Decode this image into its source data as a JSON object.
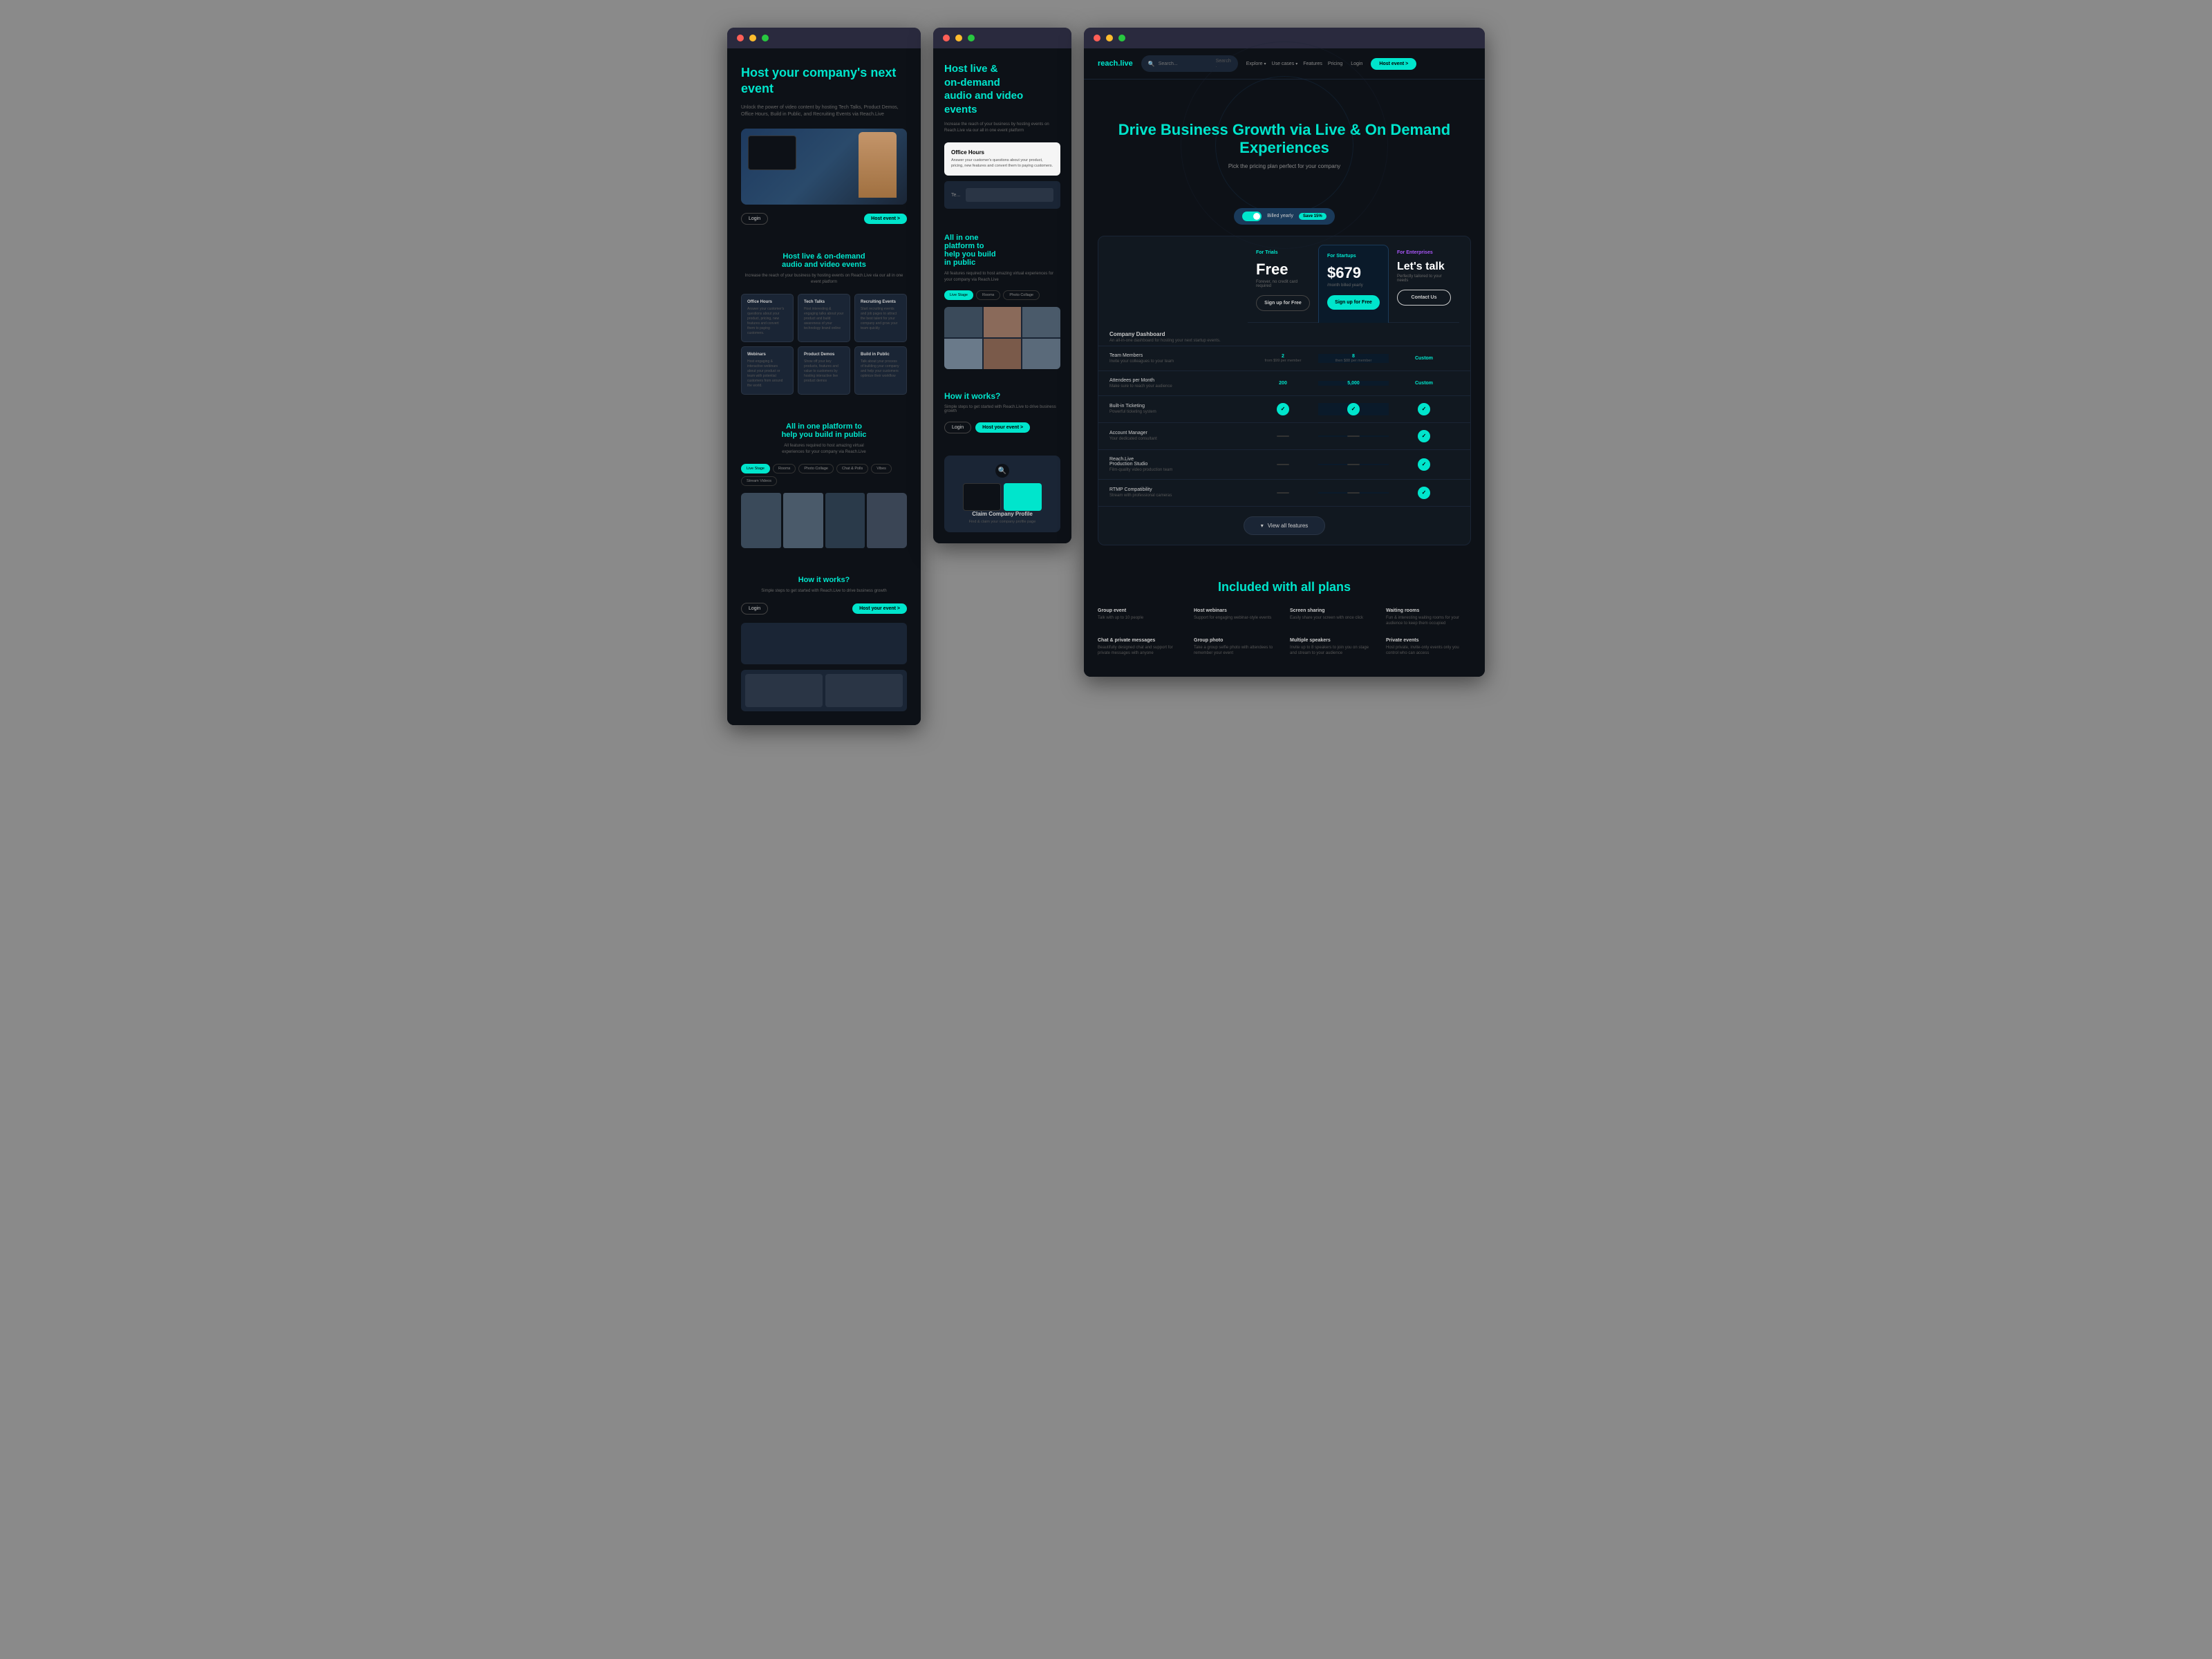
{
  "col1": {
    "hero": {
      "title": "Host your\ncompany's\nnext event",
      "subtitle": "Unlock the power of video content by hosting Tech Talks, Product Demos, Office Hours, Build in Public, and Recruiting Events via Reach.Live",
      "login_btn": "Login",
      "host_btn": "Host event >"
    },
    "section2": {
      "title": "Host live & on-demand\naudio and video events",
      "desc": "Increase the reach of your business by hosting events on\nReach.Live via our all in one event platform",
      "cards": [
        {
          "title": "Office Hours",
          "text": "Answer your customer's questions about your product, pricing, new features and convert them to paying customers."
        },
        {
          "title": "Tech Talks",
          "text": "Host interesting & engaging talks about your product and build awareness of your technology brand online"
        },
        {
          "title": "Recruiting Events",
          "text": "Start recruiting events and job pages to attract the best talent for your company and grow your team quickly"
        },
        {
          "title": "Webinars",
          "text": "Host engaging & interactive webinars about your product or team with potential customers from around the world."
        },
        {
          "title": "Product Demos",
          "text": "Show off your key products, features and value to customers by hosting interactive live product demos"
        },
        {
          "title": "Build in Public",
          "text": "Talk about your process of building your company and help your customers optimize their workflow"
        }
      ]
    },
    "section3": {
      "title": "All in one platform to\nhelp you build in public",
      "desc": "All features required to host amazing virtual\nexperiences for your company via Reach.Live",
      "tabs": [
        "Live Stage",
        "Rooms",
        "Photo Collage",
        "Chat & Polls",
        "Vibes",
        "Stream Videos"
      ]
    },
    "section4": {
      "title": "How it works?",
      "subtitle": "Simple steps to get started with\nReach.Live to drive business growth",
      "login_btn": "Login",
      "host_btn": "Host your event >"
    }
  },
  "col2": {
    "hero": {
      "title": "Host live &\non-demand\naudio and video\nevents",
      "desc": "Increase the reach of your business by hosting events on Reach.Live via our all in one event platform",
      "office_card_title": "Office Hours",
      "office_card_desc": "Answer your customer's questions about your product, pricing, new features and convert them to paying customers."
    },
    "section2": {
      "title": "All in one\nplatform to\nhelp you build\nin public",
      "desc": "All features required to host amazing virtual experiences for your company via Reach.Live",
      "tabs": [
        "Live Stage",
        "Rooms",
        "Photo Collage"
      ]
    },
    "section3": {
      "title": "How it works?",
      "desc": "Simple steps to get started with Reach.Live to drive business growth",
      "login_btn": "Login",
      "host_btn": "Host your event >"
    },
    "claim": {
      "title": "Claim Company Profile",
      "desc": "Find & claim your company profile page"
    }
  },
  "col3": {
    "navbar": {
      "logo": "reach.live",
      "search_placeholder": "Search...",
      "nav_items": [
        "Explore",
        "Use cases",
        "Features",
        "Pricing"
      ],
      "login_btn": "Login",
      "host_btn": "Host event >"
    },
    "pricing_hero": {
      "title": "Drive Business Growth via Live\n& On Demand Experiences",
      "subtitle": "Pick the pricing plan perfect for your company"
    },
    "billing_toggle": {
      "label": "Billed yearly",
      "save": "Save 15%"
    },
    "plans": [
      {
        "label": "For Trials",
        "price": "Free",
        "note": "Forever, no credit card required",
        "btn": "Sign up for Free",
        "btn_type": "outline"
      },
      {
        "label": "For Startups",
        "price": "$679",
        "note": "/month billed yearly",
        "btn": "Sign up for Free",
        "btn_type": "teal"
      },
      {
        "label": "For Enterprises",
        "price": "Let's talk",
        "note": "Perfectly tailored to your needs",
        "btn": "Contact Us",
        "btn_type": "outline"
      }
    ],
    "table": {
      "section_title": "Company Dashboard",
      "section_desc": "An all-in-one dashboard for hosting your next startup events.",
      "rows": [
        {
          "label": "Team Members",
          "sublabel": "Invite your colleagues to your team",
          "free": "2",
          "free_sub": "from $99 per member",
          "startup": "8",
          "startup_sub": "then $88 per member",
          "enterprise": "Custom"
        },
        {
          "label": "Attendees per Month",
          "sublabel": "Make sure to reach your audience",
          "free": "200",
          "free_sub": "",
          "startup": "5,000",
          "startup_sub": "",
          "enterprise": "Custom"
        },
        {
          "label": "Built-in Ticketing",
          "sublabel": "Powerful ticketing system",
          "free": "check",
          "startup": "check",
          "enterprise": "check"
        },
        {
          "label": "Account Manager",
          "sublabel": "Your dedicated consultant",
          "free": "dash",
          "startup": "dash",
          "enterprise": "check"
        },
        {
          "label": "Reach.Live Production Studio",
          "sublabel": "Film-quality video production team",
          "free": "dash",
          "startup": "dash",
          "enterprise": "check"
        },
        {
          "label": "RTMP Compatibility",
          "sublabel": "Stream with professional cameras",
          "free": "dash",
          "startup": "dash",
          "enterprise": "check"
        }
      ],
      "view_all_btn": "View all features"
    },
    "included": {
      "title": "Included with all plans",
      "items": [
        {
          "title": "Group event",
          "desc": "Talk with up to 10 people"
        },
        {
          "title": "Host webinars",
          "desc": "Support for engaging webinar-style events"
        },
        {
          "title": "Screen sharing",
          "desc": "Easily share your screen with once click"
        },
        {
          "title": "Waiting rooms",
          "desc": "Fun & interesting waiting rooms for your audience to keep them occupied"
        },
        {
          "title": "Chat & private messages",
          "desc": "Beautifully designed chat and support for private messages with anyone"
        },
        {
          "title": "Group photo",
          "desc": "Take a group selfie photo with attendees to remember your event"
        },
        {
          "title": "Multiple speakers",
          "desc": "Invite up to 8 speakers to join you on stage and stream to your audience"
        },
        {
          "title": "Private events",
          "desc": "Host private, invite-only events only you control who can access"
        }
      ]
    }
  }
}
